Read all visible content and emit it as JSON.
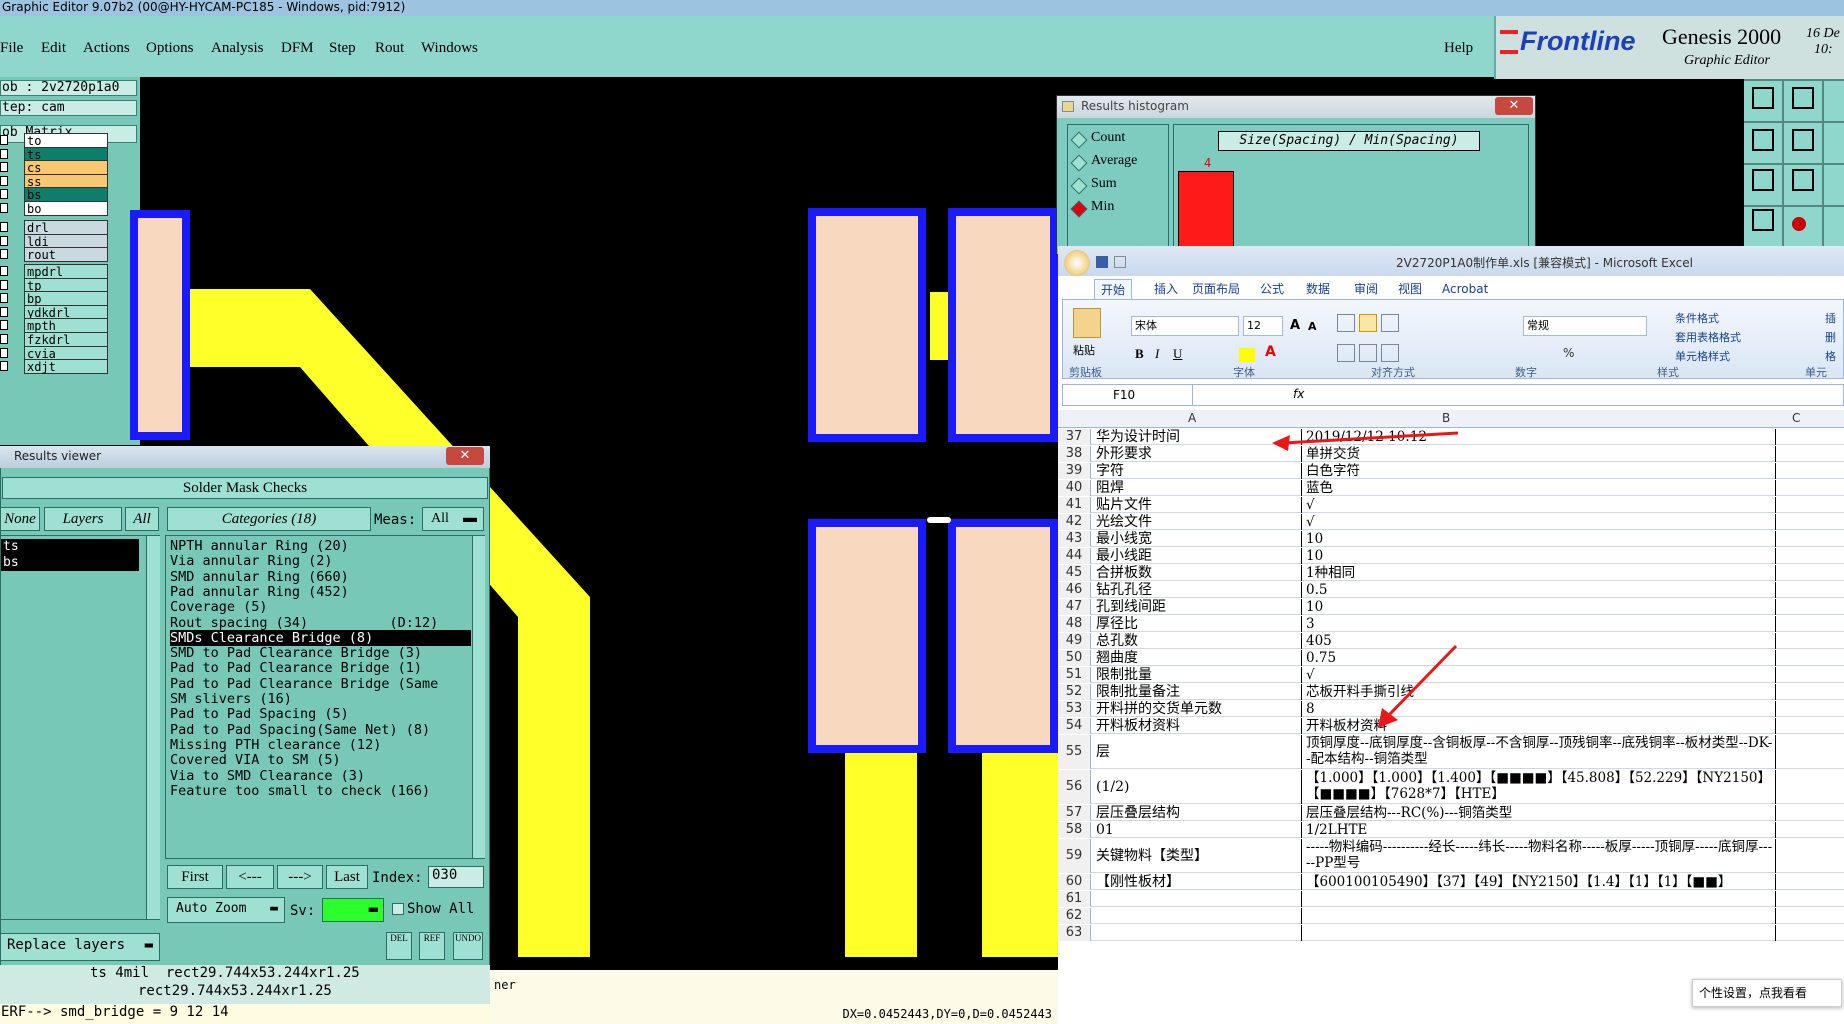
{
  "window_title": "Graphic Editor 9.07b2 (00@HY-HYCAM-PC185 - Windows, pid:7912)",
  "menu": [
    "File",
    "Edit",
    "Actions",
    "Options",
    "Analysis",
    "DFM",
    "Step",
    "Rout",
    "Windows"
  ],
  "help": "Help",
  "brand": {
    "logo": "Frontline",
    "product": "Genesis 2000",
    "subtitle": "Graphic Editor",
    "date1": "16 De",
    "date2": "10:"
  },
  "left": {
    "job": "ob : 2v2720p1a0",
    "step": "tep: cam",
    "matrix": "ob Matrix ...",
    "layers": [
      {
        "name": "to",
        "color": "#ffffff"
      },
      {
        "name": "ts",
        "color": "#0c7f6c"
      },
      {
        "name": "cs",
        "color": "#f9c770"
      },
      {
        "name": "ss",
        "color": "#f9c770"
      },
      {
        "name": "bs",
        "color": "#0c7f6c"
      },
      {
        "name": "bo",
        "color": "#ffffff"
      }
    ],
    "drill": [
      "drl",
      "ldi",
      "rout"
    ],
    "more": [
      "mpdrl",
      "tp",
      "bp",
      "ydkdrl",
      "mpth",
      "fzkdrl",
      "cvia",
      "xdjt"
    ]
  },
  "results_viewer": {
    "title": "Results viewer",
    "header": "Solder Mask Checks",
    "none": "None",
    "layers": "Layers",
    "all": "All",
    "categories": "Categories (18)",
    "meas_label": "Meas:",
    "meas_value": "All",
    "layer_items": [
      "ts",
      "bs"
    ],
    "items": [
      "NPTH annular Ring (20)",
      "Via annular Ring (2)",
      "SMD annular Ring (660)",
      "Pad annular Ring (452)",
      "Coverage (5)",
      "Rout spacing (34)          (D:12)",
      "SMDs Clearance Bridge (8)",
      "SMD to Pad Clearance Bridge (3)",
      "Pad to Pad Clearance Bridge (1)",
      "Pad to Pad Clearance Bridge (Same",
      "SM slivers (16)",
      "Pad to Pad Spacing (5)",
      "Pad to Pad Spacing(Same Net) (8)",
      "Missing PTH clearance (12)",
      "Covered VIA to SM (5)",
      "Via to SMD Clearance (3)",
      "Feature too small to check (166)"
    ],
    "first": "First",
    "prev": "<---",
    "next": "--->",
    "last": "Last",
    "index_label": "Index:",
    "index_value": "030",
    "auto_zoom": "Auto Zoom",
    "sv": "Sv:",
    "show_all": "Show All",
    "replace": "Replace layers",
    "del": "DEL",
    "ref": "REF",
    "undo": "UNDO"
  },
  "status": {
    "line1": "ts 4mil  rect29.744x53.244xr1.25",
    "line2": "rect29.744x53.244xr1.25",
    "erf": "ERF--> smd_bridge = 9 12 14",
    "coords": "DX=0.0452443,DY=0,D=0.0452443",
    "ner": "ner"
  },
  "histogram": {
    "title": "Results histogram",
    "options": [
      "Count",
      "Average",
      "Sum",
      "Min"
    ],
    "selected": "Min",
    "axis_title": "Size(Spacing) / Min(Spacing)",
    "bar_label": "4",
    "bar_color": "#ff1a1a"
  },
  "excel": {
    "file_title": "2V2720P1A0制作单.xls  [兼容模式] - Microsoft Excel",
    "tabs": [
      "开始",
      "插入",
      "页面布局",
      "公式",
      "数据",
      "审阅",
      "视图",
      "Acrobat"
    ],
    "font": "宋体",
    "size": "12",
    "number_format": "常规",
    "groups": [
      "剪贴板",
      "字体",
      "对齐方式",
      "数字",
      "样式",
      "单元"
    ],
    "paste": "粘贴",
    "styles": [
      "条件格式",
      "套用表格格式",
      "单元格样式"
    ],
    "insert_partial": "插",
    "delete_partial": "删",
    "format_partial": "格",
    "name_box": "F10",
    "fx": "fx",
    "cols": [
      "A",
      "B",
      "C"
    ],
    "rows": [
      [
        "37",
        "华为设计时间",
        "2019/12/12 10:12"
      ],
      [
        "38",
        "外形要求",
        "单拼交货"
      ],
      [
        "39",
        "字符",
        "白色字符"
      ],
      [
        "40",
        "阻焊",
        "蓝色"
      ],
      [
        "41",
        "贴片文件",
        "√"
      ],
      [
        "42",
        "光绘文件",
        "√"
      ],
      [
        "43",
        "最小线宽",
        "10"
      ],
      [
        "44",
        "最小线距",
        "10"
      ],
      [
        "45",
        "合拼板数",
        "1种相同"
      ],
      [
        "46",
        "钻孔孔径",
        "0.5"
      ],
      [
        "47",
        "孔到线间距",
        "10"
      ],
      [
        "48",
        "厚径比",
        "3"
      ],
      [
        "49",
        "总孔数",
        "405"
      ],
      [
        "50",
        "翘曲度",
        "0.75"
      ],
      [
        "51",
        "限制批量",
        "√"
      ],
      [
        "52",
        "限制批量备注",
        "芯板开料手撕引线"
      ],
      [
        "53",
        "开料拼的交货单元数",
        "8"
      ],
      [
        "54",
        "开料板材资料",
        "开料板材资料"
      ],
      [
        "55",
        "层",
        "顶铜厚度--底铜厚度--含铜板厚--不含铜厚--顶残铜率--底残铜率--板材类型--DK--配本结构--铜箔类型"
      ],
      [
        "56",
        "(1/2)",
        "【1.000】【1.000】【1.400】【■■■■】【45.808】【52.229】【NY2150】【■■■■】【7628*7】【HTE】"
      ],
      [
        "57",
        "层压叠层结构",
        "层压叠层结构---RC(%)---铜箔类型"
      ],
      [
        "58",
        "01",
        "1/2LHTE"
      ],
      [
        "59",
        "关键物料【类型】",
        "-----物料编码----------经长-----纬长-----物料名称-----板厚-----顶铜厚-----底铜厚-----PP型号"
      ],
      [
        "60",
        "【刚性板材】",
        "【600100105490】【37】【49】【NY2150】【1.4】【1】【1】【■■】"
      ],
      [
        "61",
        "",
        ""
      ],
      [
        "62",
        "",
        ""
      ],
      [
        "63",
        "",
        ""
      ]
    ],
    "tooltip": "个性设置，点我看看"
  }
}
